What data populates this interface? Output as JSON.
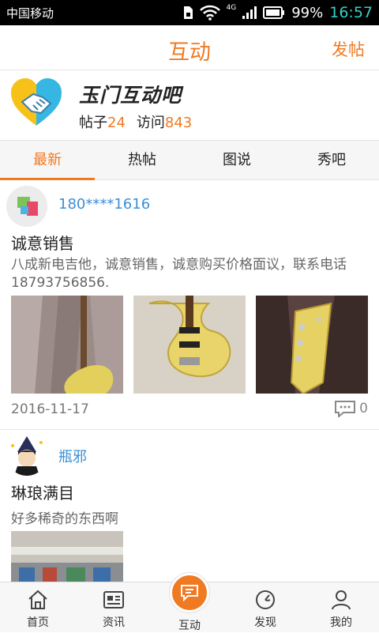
{
  "status_bar": {
    "carrier": "中国移动",
    "network": "4G",
    "battery": "99%",
    "time": "16:57"
  },
  "header": {
    "title": "互动",
    "post_button": "发帖"
  },
  "forum": {
    "name": "玉门互动吧",
    "posts_label": "帖子",
    "posts_count": "24",
    "visits_label": "访问",
    "visits_count": "843"
  },
  "tabs": [
    {
      "label": "最新",
      "active": true
    },
    {
      "label": "热帖",
      "active": false
    },
    {
      "label": "图说",
      "active": false
    },
    {
      "label": "秀吧",
      "active": false
    }
  ],
  "posts": [
    {
      "username": "180****1616",
      "title": "诚意销售",
      "body": "八成新电吉他，诚意销售，诚意购买价格面议，联系电话18793756856.",
      "date": "2016-11-17",
      "comments": "0"
    },
    {
      "username": "瓶邪",
      "title": "琳琅满目",
      "body": "好多稀奇的东西啊"
    }
  ],
  "bottom_nav": [
    {
      "label": "首页",
      "icon": "home-icon"
    },
    {
      "label": "资讯",
      "icon": "news-icon"
    },
    {
      "label": "互动",
      "icon": "chat-icon"
    },
    {
      "label": "发现",
      "icon": "compass-icon"
    },
    {
      "label": "我的",
      "icon": "user-icon"
    }
  ],
  "colors": {
    "accent": "#f07a22",
    "link": "#3a8fd6"
  }
}
